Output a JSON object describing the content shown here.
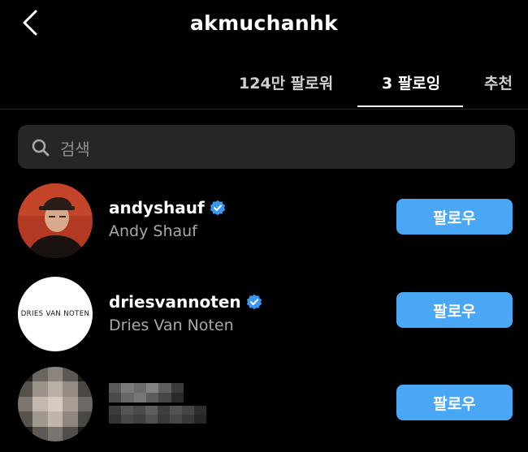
{
  "header": {
    "title": "akmuchanhk",
    "back_icon": "chevron-left-icon"
  },
  "tabs": [
    {
      "label": "124만 팔로워",
      "active": false
    },
    {
      "label": "3 팔로잉",
      "active": true
    },
    {
      "label": "추천",
      "active": false
    }
  ],
  "search": {
    "placeholder": "검색",
    "icon": "search-icon"
  },
  "following": [
    {
      "username": "andyshauf",
      "full_name": "Andy Shauf",
      "verified": true,
      "button_label": "팔로우"
    },
    {
      "username": "driesvannoten",
      "full_name": "Dries Van Noten",
      "verified": true,
      "avatar_text": "DRIES VAN NOTEN",
      "button_label": "팔로우"
    },
    {
      "username": "",
      "full_name": "",
      "verified": false,
      "obscured": true,
      "button_label": "팔로우"
    }
  ],
  "colors": {
    "background": "#000000",
    "search_bg": "#262626",
    "follow_button": "#4aa7f5",
    "verified_badge": "#3897f0",
    "secondary_text": "#a8a8a8"
  }
}
